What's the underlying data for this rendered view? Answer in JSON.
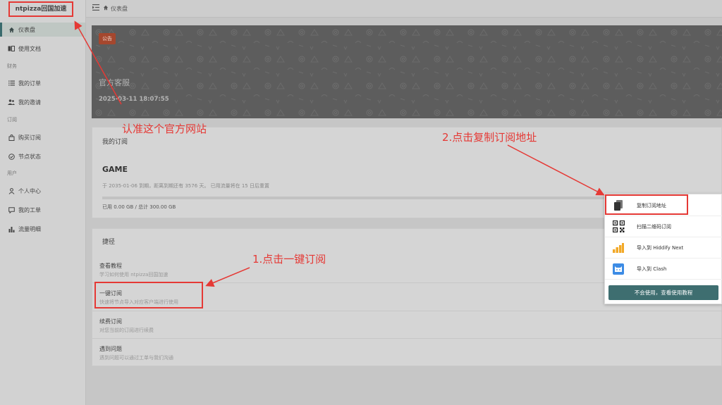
{
  "sidebar": {
    "logo": "ntpizza回国加速",
    "items": [
      {
        "label": "仪表盘",
        "icon": "home-icon",
        "active": true
      },
      {
        "label": "使用文档",
        "icon": "book-icon"
      },
      {
        "label": "我的订单",
        "icon": "list-icon"
      },
      {
        "label": "我的邀请",
        "icon": "users-icon"
      },
      {
        "label": "购买订阅",
        "icon": "bag-icon"
      },
      {
        "label": "节点状态",
        "icon": "check-circle-icon"
      },
      {
        "label": "个人中心",
        "icon": "user-icon"
      },
      {
        "label": "我的工单",
        "icon": "message-icon"
      },
      {
        "label": "流量明细",
        "icon": "bar-chart-icon"
      }
    ],
    "sections": [
      "财务",
      "订阅",
      "用户"
    ]
  },
  "topbar": {
    "breadcrumb": "仪表盘"
  },
  "banner": {
    "badge": "公告",
    "title": "官方客服",
    "time": "2025-03-11 18:07:55"
  },
  "subscription": {
    "title": "我的订阅",
    "plan": "GAME",
    "info": "于 2035-01-06 到期，距离到期还有 3576 天。 已用流量将在 15 日后重置",
    "usage": "已用 0.00 GB / 总计 300.00 GB",
    "used_fraction": 0
  },
  "shortcuts": {
    "title": "捷径",
    "items": [
      {
        "title": "查看教程",
        "desc": "学习如何使用 ntpizza回国加速"
      },
      {
        "title": "一键订阅",
        "desc": "快速将节点导入对应客户端进行使用"
      },
      {
        "title": "续费订阅",
        "desc": "对您当前的订阅进行续费"
      },
      {
        "title": "遇到问题",
        "desc": "遇到问题可以通过工单与我们沟通"
      }
    ]
  },
  "popup": {
    "items": [
      {
        "label": "复制订阅地址",
        "icon": "copy-icon"
      },
      {
        "label": "扫描二维码订阅",
        "icon": "qrcode-icon"
      },
      {
        "label": "导入到 Hiddify Next",
        "icon": "hiddify-icon"
      },
      {
        "label": "导入到 Clash",
        "icon": "clash-icon"
      }
    ],
    "button": "不会使用，查看使用教程"
  },
  "annotations": {
    "official": "认准这个官方网站",
    "step1": "1.点击一键订阅",
    "step2": "2.点击复制订阅地址"
  },
  "colors": {
    "accent": "#3e6e70",
    "annotation": "#e53935",
    "badge": "#a5472e"
  }
}
